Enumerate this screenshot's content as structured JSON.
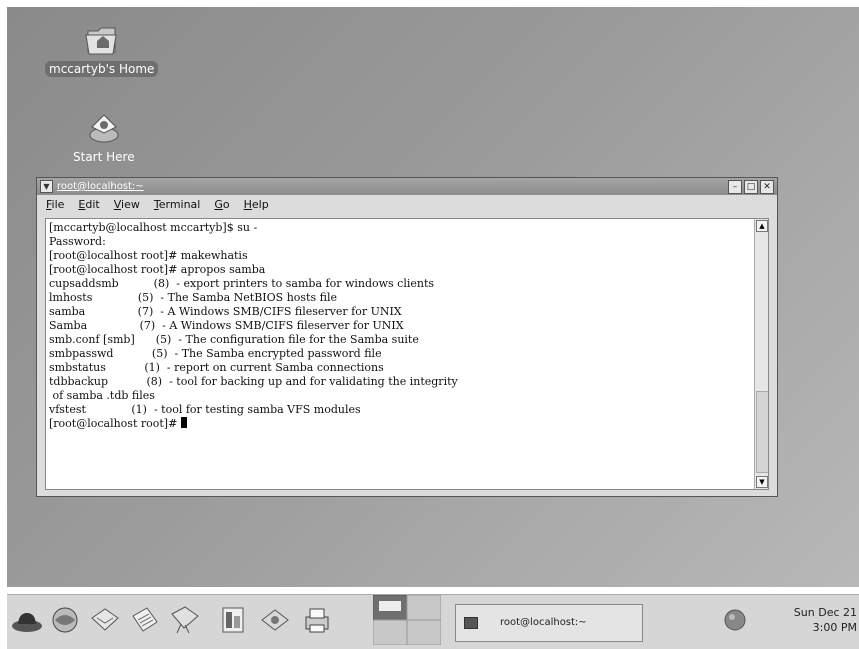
{
  "desktop": {
    "icons": [
      {
        "label": "mccartyb's Home",
        "icon": "home-folder-icon"
      },
      {
        "label": "Start Here",
        "icon": "start-here-icon"
      }
    ]
  },
  "terminal": {
    "title": "root@localhost:~",
    "menu": [
      "File",
      "Edit",
      "View",
      "Terminal",
      "Go",
      "Help"
    ],
    "lines": [
      "[mccartyb@localhost mccartyb]$ su -",
      "Password:",
      "[root@localhost root]# makewhatis",
      "[root@localhost root]# apropos samba",
      "cupsaddsmb          (8)  - export printers to samba for windows clients",
      "lmhosts             (5)  - The Samba NetBIOS hosts file",
      "samba               (7)  - A Windows SMB/CIFS fileserver for UNIX",
      "Samba               (7)  - A Windows SMB/CIFS fileserver for UNIX",
      "smb.conf [smb]      (5)  - The configuration file for the Samba suite",
      "smbpasswd           (5)  - The Samba encrypted password file",
      "smbstatus           (1)  - report on current Samba connections",
      "tdbbackup           (8)  - tool for backing up and for validating the integrity",
      " of samba .tdb files",
      "vfstest             (1)  - tool for testing samba VFS modules"
    ],
    "prompt": "[root@localhost root]# "
  },
  "taskbar": {
    "task_label": "root@localhost:~",
    "clock_date": "Sun Dec 21",
    "clock_time": "3:00 PM"
  }
}
